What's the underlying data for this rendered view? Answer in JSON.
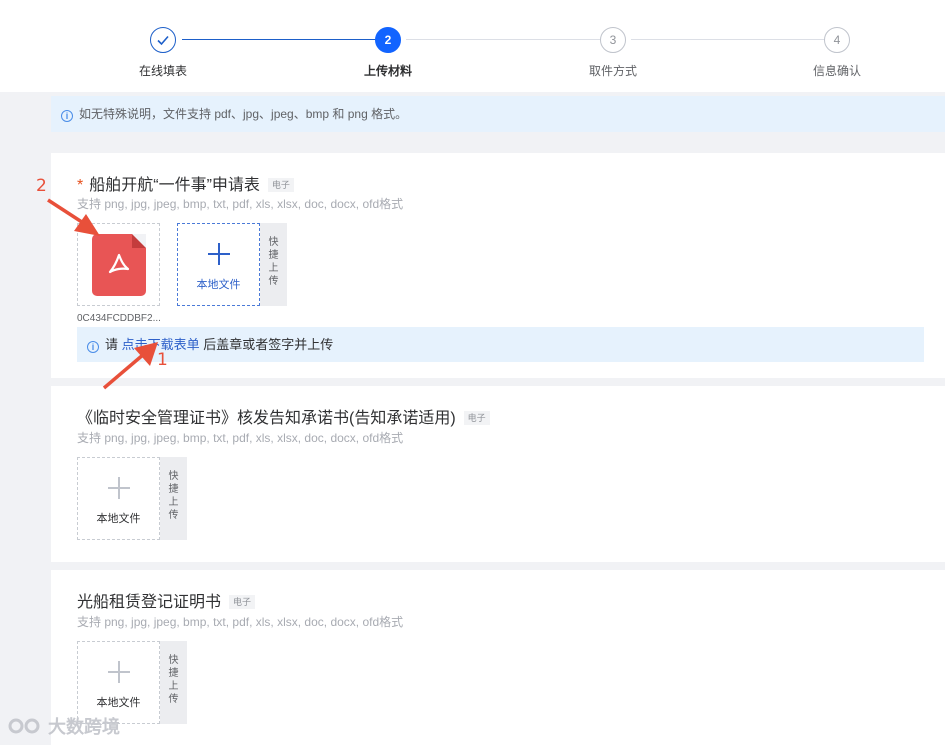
{
  "steps": [
    {
      "index": "1",
      "label": "在线填表",
      "state": "done"
    },
    {
      "index": "2",
      "label": "上传材料",
      "state": "active"
    },
    {
      "index": "3",
      "label": "取件方式",
      "state": "pending"
    },
    {
      "index": "4",
      "label": "信息确认",
      "state": "pending"
    }
  ],
  "notice": {
    "text": "如无特殊说明，文件支持 pdf、jpg、jpeg、bmp 和 png 格式。"
  },
  "sections": [
    {
      "required": "*",
      "title": "船舶开航“一件事”申请表",
      "tag": "电子",
      "formats": "支持 png, jpg, jpeg, bmp, txt, pdf, xls, xlsx, doc, docx, ofd格式",
      "file_name": "0C434FCDDBF2...",
      "upload_label": "本地文件",
      "quick_upload": [
        "快",
        "捷",
        "上",
        "传"
      ],
      "hint_prefix": "请",
      "hint_link": "点击下载表单",
      "hint_suffix": "后盖章或者签字并上传"
    },
    {
      "title": "《临时安全管理证书》核发告知承诺书(告知承诺适用)",
      "tag": "电子",
      "formats": "支持 png, jpg, jpeg, bmp, txt, pdf, xls, xlsx, doc, docx, ofd格式",
      "upload_label": "本地文件",
      "quick_upload": [
        "快",
        "捷",
        "上",
        "传"
      ]
    },
    {
      "title": "光船租赁登记证明书",
      "tag": "电子",
      "formats": "支持 png, jpg, jpeg, bmp, txt, pdf, xls, xlsx, doc, docx, ofd格式",
      "upload_label": "本地文件",
      "quick_upload": [
        "快",
        "捷",
        "上",
        "传"
      ]
    }
  ],
  "annotations": {
    "one": "1",
    "two": "2",
    "color": "#e8503a"
  },
  "watermark": {
    "text": "大数跨境"
  },
  "colors": {
    "primary": "#1264ff",
    "link": "#2d60c9",
    "info_bg": "#e6f2fd",
    "required": "#e6501d"
  }
}
